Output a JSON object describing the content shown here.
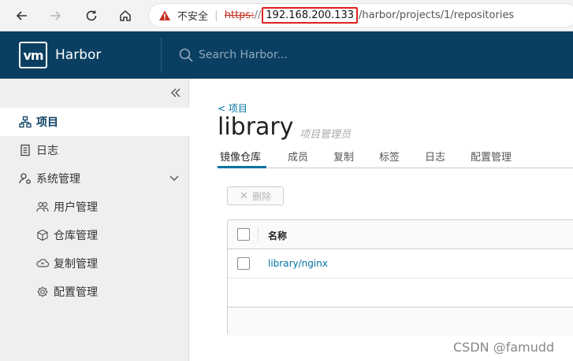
{
  "browser": {
    "insecure_label": "不安全",
    "separator": "|",
    "url_scheme": "https:",
    "url_slashes": "//",
    "url_host": "192.168.200.133",
    "url_path": "/harbor/projects/1/repositories",
    "icons": [
      "back-icon",
      "forward-icon",
      "reload-icon",
      "home-icon",
      "warning-icon"
    ]
  },
  "header": {
    "logo_text": "vm",
    "app_name": "Harbor",
    "search_placeholder": "Search Harbor...",
    "background_color": "#0a3f62"
  },
  "sidebar": {
    "items": [
      {
        "label": "项目",
        "icon": "projects-icon",
        "active": true
      },
      {
        "label": "日志",
        "icon": "logs-icon",
        "active": false
      },
      {
        "label": "系统管理",
        "icon": "admin-icon",
        "active": false,
        "expanded": true
      }
    ],
    "sub_items": [
      {
        "label": "用户管理",
        "icon": "users-icon"
      },
      {
        "label": "仓库管理",
        "icon": "registry-icon"
      },
      {
        "label": "复制管理",
        "icon": "replication-icon"
      },
      {
        "label": "配置管理",
        "icon": "config-icon"
      }
    ]
  },
  "main": {
    "breadcrumb": "< 项目",
    "title": "library",
    "role": "项目管理员",
    "tabs": [
      {
        "label": "镜像仓库",
        "active": true
      },
      {
        "label": "成员"
      },
      {
        "label": "复制"
      },
      {
        "label": "标签"
      },
      {
        "label": "日志"
      },
      {
        "label": "配置管理"
      }
    ],
    "delete_label": "删除",
    "grid": {
      "column_name": "名称",
      "rows": [
        {
          "name": "library/nginx"
        }
      ]
    }
  },
  "watermark": "CSDN @famudd",
  "accent_color": "#0072a3"
}
